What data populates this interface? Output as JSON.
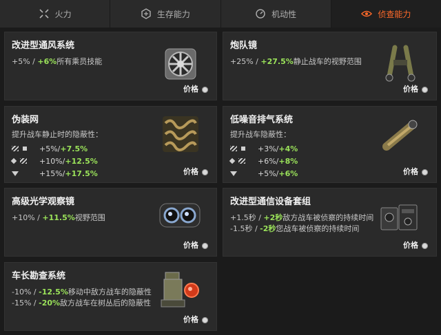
{
  "tabs": [
    {
      "label": "火力",
      "icon": "crosshair-icon"
    },
    {
      "label": "生存能力",
      "icon": "hexagon-icon"
    },
    {
      "label": "机动性",
      "icon": "speedometer-icon"
    },
    {
      "label": "侦查能力",
      "icon": "eye-icon",
      "active": true
    }
  ],
  "cards": {
    "vent": {
      "title": "改进型通风系统",
      "line1_a": "+5%",
      "line1_sep": " / ",
      "line1_b": "+6%",
      "line1_text": "所有乘员技能",
      "price": "价格"
    },
    "binoc": {
      "title": "炮队镜",
      "line1_a": "+25%",
      "line1_sep": " / ",
      "line1_b": "+27.5%",
      "line1_text": "静止战车的视野范围",
      "price": "价格"
    },
    "camo": {
      "title": "伪装网",
      "desc": "提升战车静止时的隐蔽性：",
      "rows": [
        {
          "a": "+5%",
          "b": "+7.5%"
        },
        {
          "a": "+10%",
          "b": "+12.5%"
        },
        {
          "a": "+15%",
          "b": "+17.5%"
        }
      ],
      "price": "价格"
    },
    "exhaust": {
      "title": "低噪音排气系统",
      "desc": "提升战车隐蔽性：",
      "rows": [
        {
          "a": "+3%",
          "b": "+4%"
        },
        {
          "a": "+6%",
          "b": "+8%"
        },
        {
          "a": "+5%",
          "b": "+6%"
        }
      ],
      "price": "价格"
    },
    "optics": {
      "title": "高级光学观察镜",
      "line1_a": "+10%",
      "line1_sep": " / ",
      "line1_b": "+11.5%",
      "line1_text": "视野范围",
      "price": "价格"
    },
    "radio": {
      "title": "改进型通信设备套组",
      "line1_a": "+1.5秒",
      "line1_b": "+2秒",
      "line1_text": "敌方战车被侦察的持续时间",
      "line2_a": "-1.5秒",
      "line2_b": "-2秒",
      "line2_text": "您战车被侦察的持续时间",
      "price": "价格"
    },
    "commander": {
      "title": "车长勘查系统",
      "line1_a": "-10%",
      "line1_b": "-12.5%",
      "line1_text": "移动中敌方战车的隐蔽性",
      "line2_a": "-15%",
      "line2_b": "-20%",
      "line2_text": "敌方战车在树丛后的隐蔽性",
      "price": "价格"
    }
  },
  "sep": " / ",
  "colors": {
    "accent": "#ff6a2a",
    "bonus": "#9be35a"
  }
}
